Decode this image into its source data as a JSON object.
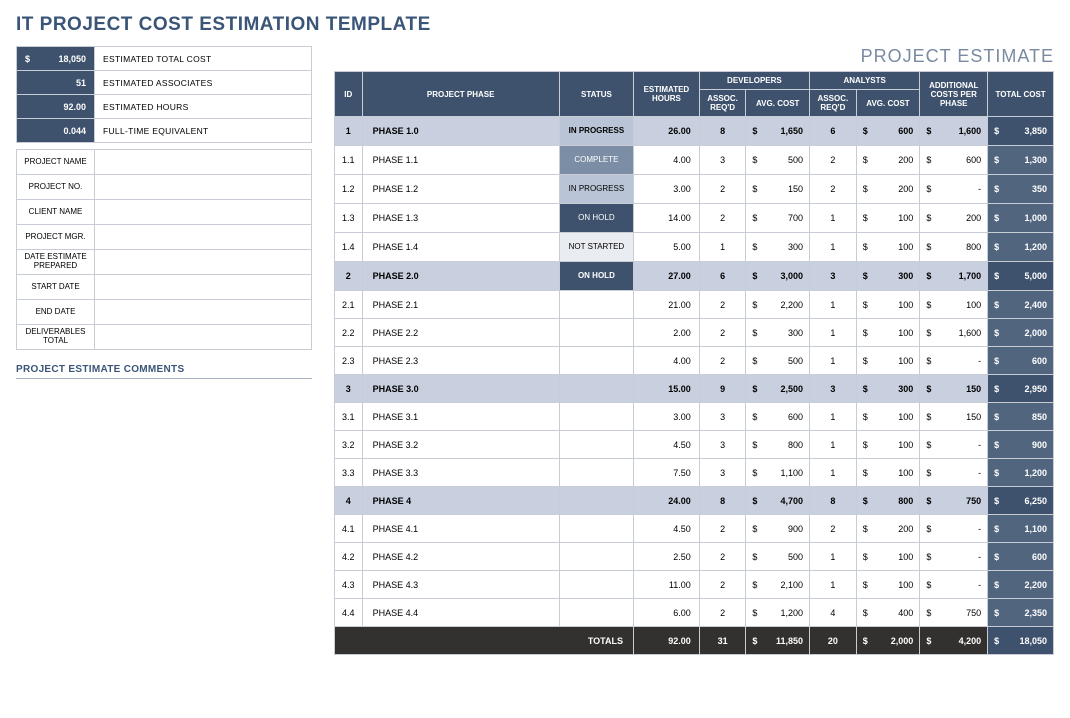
{
  "title": "IT PROJECT COST ESTIMATION TEMPLATE",
  "right_title": "PROJECT ESTIMATE",
  "summary": [
    {
      "value": "18,050",
      "label": "ESTIMATED TOTAL COST",
      "money": true
    },
    {
      "value": "51",
      "label": "ESTIMATED ASSOCIATES",
      "money": false
    },
    {
      "value": "92.00",
      "label": "ESTIMATED HOURS",
      "money": false
    },
    {
      "value": "0.044",
      "label": "FULL-TIME EQUIVALENT",
      "money": false
    }
  ],
  "info_labels": [
    "PROJECT NAME",
    "PROJECT NO.",
    "CLIENT NAME",
    "PROJECT MGR.",
    "DATE ESTIMATE PREPARED",
    "START DATE",
    "END DATE",
    "DELIVERABLES TOTAL"
  ],
  "comments_header": "PROJECT ESTIMATE COMMENTS",
  "grid": {
    "headers": {
      "id": "ID",
      "phase": "PROJECT PHASE",
      "status": "STATUS",
      "hours": "ESTIMATED HOURS",
      "devs": "DEVELOPERS",
      "analysts": "ANALYSTS",
      "assoc": "ASSOC. REQ'D",
      "avg": "AVG. COST",
      "addl": "ADDITIONAL COSTS PER PHASE",
      "total": "TOTAL COST"
    },
    "rows": [
      {
        "parent": true,
        "id": "1",
        "phase": "PHASE 1.0",
        "status": "IN PROGRESS",
        "hours": "26.00",
        "dev_assoc": "8",
        "dev_cost": "1,650",
        "an_assoc": "6",
        "an_cost": "600",
        "addl": "1,600",
        "total": "3,850"
      },
      {
        "parent": false,
        "id": "1.1",
        "phase": "PHASE 1.1",
        "status": "COMPLETE",
        "hours": "4.00",
        "dev_assoc": "3",
        "dev_cost": "500",
        "an_assoc": "2",
        "an_cost": "200",
        "addl": "600",
        "total": "1,300"
      },
      {
        "parent": false,
        "id": "1.2",
        "phase": "PHASE 1.2",
        "status": "IN PROGRESS",
        "hours": "3.00",
        "dev_assoc": "2",
        "dev_cost": "150",
        "an_assoc": "2",
        "an_cost": "200",
        "addl": "-",
        "total": "350"
      },
      {
        "parent": false,
        "id": "1.3",
        "phase": "PHASE 1.3",
        "status": "ON HOLD",
        "hours": "14.00",
        "dev_assoc": "2",
        "dev_cost": "700",
        "an_assoc": "1",
        "an_cost": "100",
        "addl": "200",
        "total": "1,000"
      },
      {
        "parent": false,
        "id": "1.4",
        "phase": "PHASE 1.4",
        "status": "NOT STARTED",
        "hours": "5.00",
        "dev_assoc": "1",
        "dev_cost": "300",
        "an_assoc": "1",
        "an_cost": "100",
        "addl": "800",
        "total": "1,200"
      },
      {
        "parent": true,
        "id": "2",
        "phase": "PHASE 2.0",
        "status": "ON HOLD",
        "hours": "27.00",
        "dev_assoc": "6",
        "dev_cost": "3,000",
        "an_assoc": "3",
        "an_cost": "300",
        "addl": "1,700",
        "total": "5,000"
      },
      {
        "parent": false,
        "id": "2.1",
        "phase": "PHASE 2.1",
        "status": "",
        "hours": "21.00",
        "dev_assoc": "2",
        "dev_cost": "2,200",
        "an_assoc": "1",
        "an_cost": "100",
        "addl": "100",
        "total": "2,400"
      },
      {
        "parent": false,
        "id": "2.2",
        "phase": "PHASE 2.2",
        "status": "",
        "hours": "2.00",
        "dev_assoc": "2",
        "dev_cost": "300",
        "an_assoc": "1",
        "an_cost": "100",
        "addl": "1,600",
        "total": "2,000"
      },
      {
        "parent": false,
        "id": "2.3",
        "phase": "PHASE 2.3",
        "status": "",
        "hours": "4.00",
        "dev_assoc": "2",
        "dev_cost": "500",
        "an_assoc": "1",
        "an_cost": "100",
        "addl": "-",
        "total": "600"
      },
      {
        "parent": true,
        "id": "3",
        "phase": "PHASE 3.0",
        "status": "",
        "hours": "15.00",
        "dev_assoc": "9",
        "dev_cost": "2,500",
        "an_assoc": "3",
        "an_cost": "300",
        "addl": "150",
        "total": "2,950"
      },
      {
        "parent": false,
        "id": "3.1",
        "phase": "PHASE 3.1",
        "status": "",
        "hours": "3.00",
        "dev_assoc": "3",
        "dev_cost": "600",
        "an_assoc": "1",
        "an_cost": "100",
        "addl": "150",
        "total": "850"
      },
      {
        "parent": false,
        "id": "3.2",
        "phase": "PHASE 3.2",
        "status": "",
        "hours": "4.50",
        "dev_assoc": "3",
        "dev_cost": "800",
        "an_assoc": "1",
        "an_cost": "100",
        "addl": "-",
        "total": "900"
      },
      {
        "parent": false,
        "id": "3.3",
        "phase": "PHASE 3.3",
        "status": "",
        "hours": "7.50",
        "dev_assoc": "3",
        "dev_cost": "1,100",
        "an_assoc": "1",
        "an_cost": "100",
        "addl": "-",
        "total": "1,200"
      },
      {
        "parent": true,
        "id": "4",
        "phase": "PHASE 4",
        "status": "",
        "hours": "24.00",
        "dev_assoc": "8",
        "dev_cost": "4,700",
        "an_assoc": "8",
        "an_cost": "800",
        "addl": "750",
        "total": "6,250"
      },
      {
        "parent": false,
        "id": "4.1",
        "phase": "PHASE 4.1",
        "status": "",
        "hours": "4.50",
        "dev_assoc": "2",
        "dev_cost": "900",
        "an_assoc": "2",
        "an_cost": "200",
        "addl": "-",
        "total": "1,100"
      },
      {
        "parent": false,
        "id": "4.2",
        "phase": "PHASE 4.2",
        "status": "",
        "hours": "2.50",
        "dev_assoc": "2",
        "dev_cost": "500",
        "an_assoc": "1",
        "an_cost": "100",
        "addl": "-",
        "total": "600"
      },
      {
        "parent": false,
        "id": "4.3",
        "phase": "PHASE 4.3",
        "status": "",
        "hours": "11.00",
        "dev_assoc": "2",
        "dev_cost": "2,100",
        "an_assoc": "1",
        "an_cost": "100",
        "addl": "-",
        "total": "2,200"
      },
      {
        "parent": false,
        "id": "4.4",
        "phase": "PHASE 4.4",
        "status": "",
        "hours": "6.00",
        "dev_assoc": "2",
        "dev_cost": "1,200",
        "an_assoc": "4",
        "an_cost": "400",
        "addl": "750",
        "total": "2,350"
      }
    ],
    "totals": {
      "label": "TOTALS",
      "hours": "92.00",
      "dev_assoc": "31",
      "dev_cost": "11,850",
      "an_assoc": "20",
      "an_cost": "2,000",
      "addl": "4,200",
      "total": "18,050"
    }
  },
  "status_map": {
    "IN PROGRESS": "st-progress",
    "COMPLETE": "st-complete",
    "ON HOLD": "st-hold",
    "NOT STARTED": "st-notstarted"
  }
}
